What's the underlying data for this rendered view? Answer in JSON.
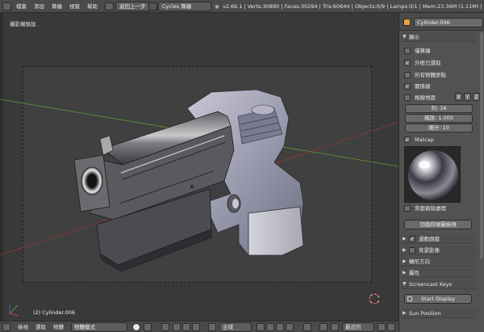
{
  "menu": {
    "items": [
      "檔案",
      "添加",
      "算繪",
      "視窗",
      "幫助"
    ],
    "back_button": "返回上一步",
    "engine": "Cycles 算繪",
    "stats": "v2.66.1 | Verts:30890 | Faces:30294 | Tris:60644 | Objects:0/9 | Lamps:0/1 | Mem:23.36M (1.11M) | C"
  },
  "viewport": {
    "camera_label": "攝影機預設",
    "object_label": "(2) Cylinder.006"
  },
  "bottom": {
    "menus": [
      "檢視",
      "選取",
      "物體"
    ],
    "mode": "物體模式",
    "pivot": "全域",
    "snap": "最近的"
  },
  "panel": {
    "object_name": "Cylinder.006",
    "display_header": "顯示",
    "options": [
      {
        "label": "僅算繪",
        "checked": false
      },
      {
        "label": "外框已選取",
        "checked": true
      },
      {
        "label": "所有物體原點",
        "checked": false
      },
      {
        "label": "關係線",
        "checked": true
      }
    ],
    "grid_floor": {
      "label": "格線地面",
      "checked": false
    },
    "axes": [
      "X",
      "Y",
      "Z"
    ],
    "lines": "列: 16",
    "scale": "縮放: 1.000",
    "subdivisions": "細分: 10",
    "matcap": {
      "label": "Matcap",
      "checked": true
    },
    "backface": {
      "label": "背面剔除處理",
      "checked": false
    },
    "toggle_quad_view": "切換四視圖檢視",
    "motion_tracking": {
      "label": "運動跟蹤",
      "checked": true
    },
    "background_images": {
      "label": "背景影像",
      "checked": false
    },
    "transform_orientation": "轉形方向",
    "properties": "屬性",
    "screencast_header": "Screencast Keys",
    "start_display": "Start Display",
    "sun_position": "Sun Position"
  },
  "colors": {
    "x_axis_line": "#9a3434",
    "y_axis_line": "#5c9a34",
    "selection_outline": "#ff9f2a"
  }
}
